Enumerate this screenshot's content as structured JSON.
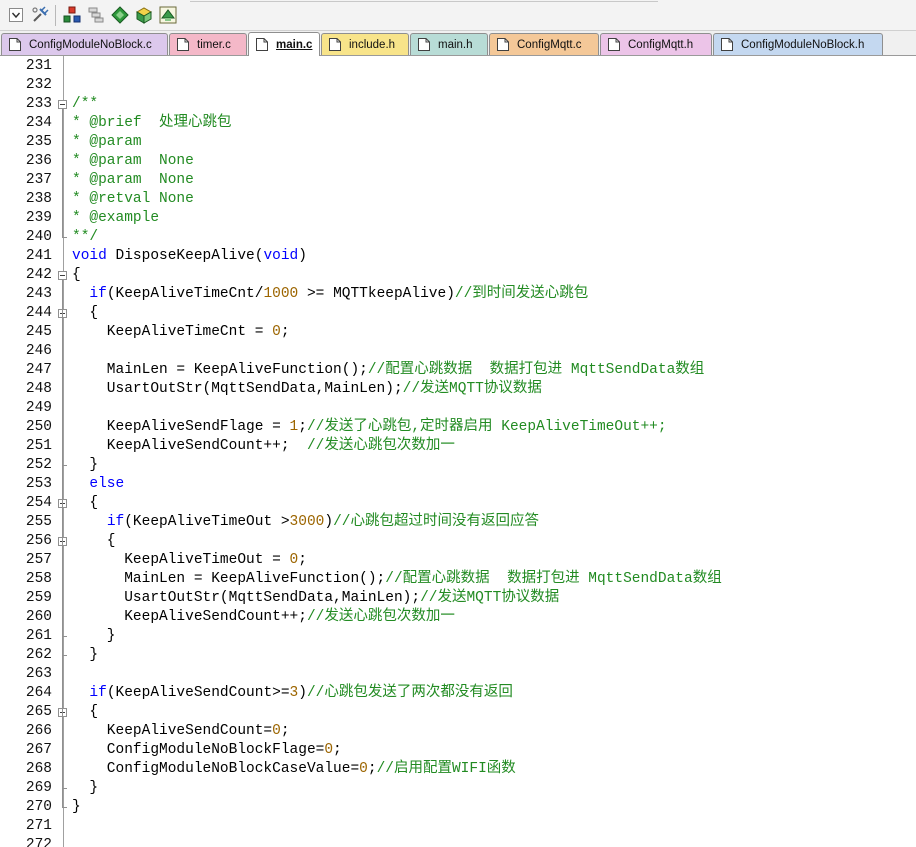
{
  "toolbar": {
    "buttons": [
      {
        "icon": "dropdown-icon"
      },
      {
        "icon": "configure-tools-icon"
      },
      {
        "icon": "manage-components-icon"
      },
      {
        "icon": "multi-project-icon"
      },
      {
        "icon": "select-device-icon"
      },
      {
        "icon": "pack-installer-icon"
      },
      {
        "icon": "build-manager-icon"
      }
    ]
  },
  "tabs": [
    {
      "label": "ConfigModuleNoBlock.c",
      "color": "#dcc8ec"
    },
    {
      "label": "timer.c",
      "color": "#f4b8c8"
    },
    {
      "label": "main.c",
      "color": "#ffffff",
      "active": true
    },
    {
      "label": "include.h",
      "color": "#f8e48a"
    },
    {
      "label": "main.h",
      "color": "#b8dcd6"
    },
    {
      "label": "ConfigMqtt.c",
      "color": "#f4c898"
    },
    {
      "label": "ConfigMqtt.h",
      "color": "#ecc4e8"
    },
    {
      "label": "ConfigModuleNoBlock.h",
      "color": "#c4d8f0"
    }
  ],
  "code_lines": [
    {
      "n": "231",
      "t": ""
    },
    {
      "n": "232",
      "t": ""
    },
    {
      "n": "233",
      "t": "/**"
    },
    {
      "n": "234",
      "t": "* @brief  处理心跳包"
    },
    {
      "n": "235",
      "t": "* @param"
    },
    {
      "n": "236",
      "t": "* @param  None"
    },
    {
      "n": "237",
      "t": "* @param  None"
    },
    {
      "n": "238",
      "t": "* @retval None"
    },
    {
      "n": "239",
      "t": "* @example"
    },
    {
      "n": "240",
      "t": "**/"
    },
    {
      "n": "241",
      "t": "void DisposeKeepAlive(void)"
    },
    {
      "n": "242",
      "t": "{"
    },
    {
      "n": "243",
      "t": "  if(KeepAliveTimeCnt/1000 >= MQTTkeepAlive)//到时间发送心跳包"
    },
    {
      "n": "244",
      "t": "  {"
    },
    {
      "n": "245",
      "t": "    KeepAliveTimeCnt = 0;"
    },
    {
      "n": "246",
      "t": ""
    },
    {
      "n": "247",
      "t": "    MainLen = KeepAliveFunction();//配置心跳数据  数据打包进 MqttSendData数组"
    },
    {
      "n": "248",
      "t": "    UsartOutStr(MqttSendData,MainLen);//发送MQTT协议数据"
    },
    {
      "n": "249",
      "t": ""
    },
    {
      "n": "250",
      "t": "    KeepAliveSendFlage = 1;//发送了心跳包,定时器启用 KeepAliveTimeOut++;"
    },
    {
      "n": "251",
      "t": "    KeepAliveSendCount++;  //发送心跳包次数加一"
    },
    {
      "n": "252",
      "t": "  }"
    },
    {
      "n": "253",
      "t": "  else"
    },
    {
      "n": "254",
      "t": "  {"
    },
    {
      "n": "255",
      "t": "    if(KeepAliveTimeOut >3000)//心跳包超过时间没有返回应答"
    },
    {
      "n": "256",
      "t": "    {"
    },
    {
      "n": "257",
      "t": "      KeepAliveTimeOut = 0;"
    },
    {
      "n": "258",
      "t": "      MainLen = KeepAliveFunction();//配置心跳数据  数据打包进 MqttSendData数组"
    },
    {
      "n": "259",
      "t": "      UsartOutStr(MqttSendData,MainLen);//发送MQTT协议数据"
    },
    {
      "n": "260",
      "t": "      KeepAliveSendCount++;//发送心跳包次数加一"
    },
    {
      "n": "261",
      "t": "    }"
    },
    {
      "n": "262",
      "t": "  }"
    },
    {
      "n": "263",
      "t": ""
    },
    {
      "n": "264",
      "t": "  if(KeepAliveSendCount>=3)//心跳包发送了两次都没有返回"
    },
    {
      "n": "265",
      "t": "  {"
    },
    {
      "n": "266",
      "t": "    KeepAliveSendCount=0;"
    },
    {
      "n": "267",
      "t": "    ConfigModuleNoBlockFlage=0;"
    },
    {
      "n": "268",
      "t": "    ConfigModuleNoBlockCaseValue=0;//启用配置WIFI函数"
    },
    {
      "n": "269",
      "t": "  }"
    },
    {
      "n": "270",
      "t": "}"
    },
    {
      "n": "271",
      "t": ""
    },
    {
      "n": "272",
      "t": ""
    }
  ],
  "fold_lines": [
    "233",
    "242",
    "244",
    "254",
    "256",
    "265"
  ],
  "colors": {
    "keyword": "#0000ff",
    "number": "#9c6500",
    "comment": "#228b22",
    "text": "#000000"
  }
}
